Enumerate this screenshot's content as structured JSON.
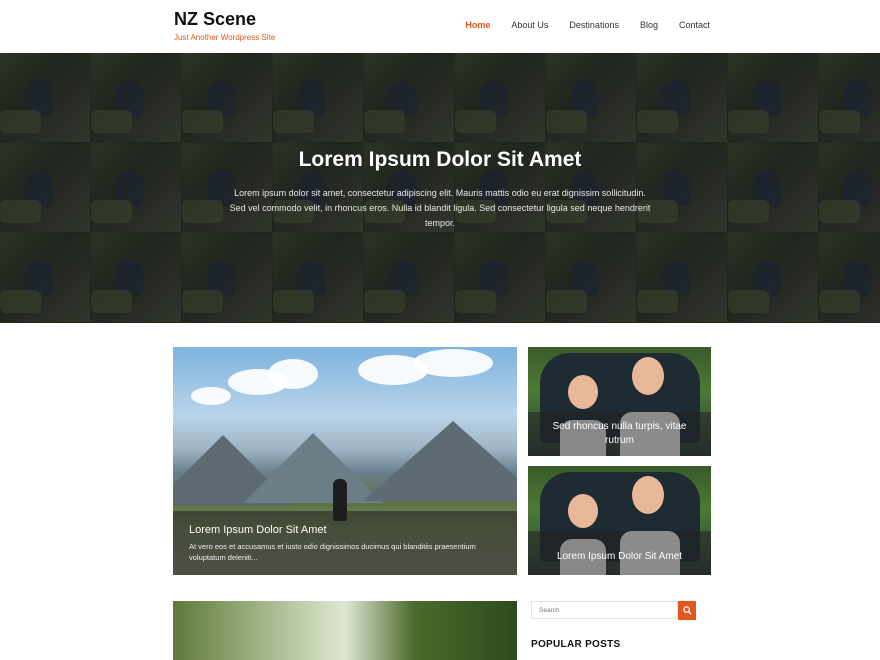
{
  "site": {
    "title": "NZ Scene",
    "tagline": "Just Another Wordpress Site",
    "accent_color": "#e2571e"
  },
  "nav": {
    "items": [
      {
        "label": "Home",
        "active": true
      },
      {
        "label": "About Us",
        "active": false
      },
      {
        "label": "Destinations",
        "active": false
      },
      {
        "label": "Blog",
        "active": false
      },
      {
        "label": "Contact",
        "active": false
      }
    ]
  },
  "hero": {
    "title": "Lorem Ipsum Dolor Sit Amet",
    "text": "Lorem ipsum dolor sit amet, consectetur adipiscing elit. Mauris mattis odio eu erat dignissim sollicitudin. Sed vel commodo velit, in rhoncus eros. Nulla id blandit ligula. Sed consectetur ligula sed neque hendrerit tempor."
  },
  "featured": {
    "main": {
      "title": "Lorem Ipsum Dolor Sit Amet",
      "excerpt": "At vero eos et accusamus et iusto odio dignissimos ducimus qui blanditiis praesentium voluptatum deleniti..."
    },
    "side": [
      {
        "title": "Sed rhoncus nulla turpis, vitae rutrum"
      },
      {
        "title": "Lorem Ipsum Dolor Sit Amet"
      }
    ]
  },
  "sidebar": {
    "search_placeholder": "Search",
    "search_icon": "search-icon",
    "popular_posts_heading": "POPULAR POSTS"
  }
}
